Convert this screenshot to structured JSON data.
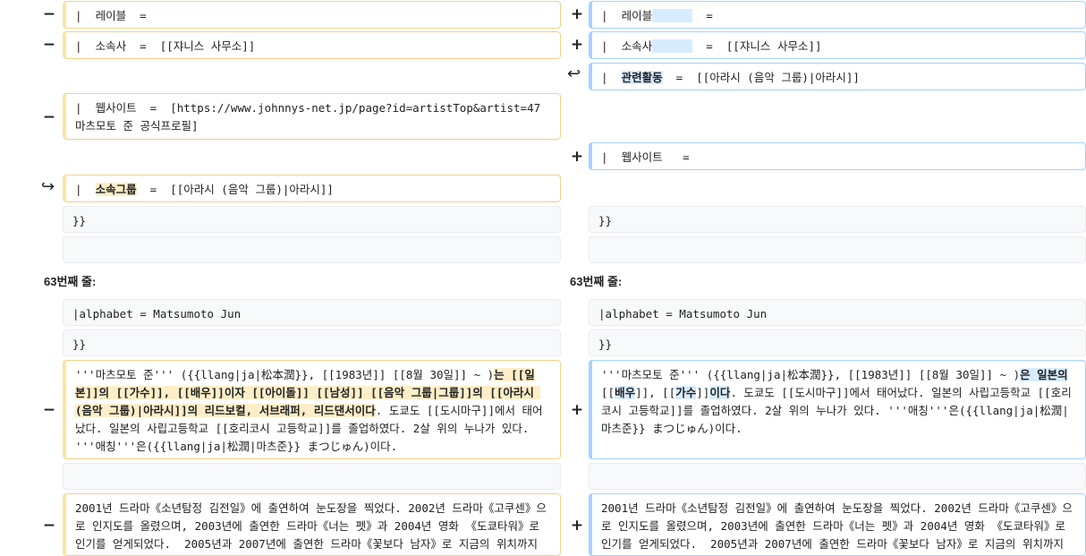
{
  "markers": {
    "minus": "−",
    "plus": "+",
    "move_to": "↩",
    "move_from": "↪"
  },
  "rows": {
    "r1": {
      "left": "|  레이블  =",
      "right_a": "|  레이블",
      "right_b": "  ="
    },
    "r2": {
      "left": "|  소속사  =  [[쟈니스 사무소]]",
      "right_a": "|  소속사",
      "right_b": "  =  [[쟈니스 사무소]]"
    },
    "r3": {
      "right_a": "|  ",
      "right_hl": "관련활동",
      "right_b": "  =  [[아라시 (음악 그룹)|아라시]]"
    },
    "r4": {
      "left": "|  웹사이트  =  [https://www.johnnys-net.jp/page?id=artistTop&artist=47 마츠모토 준 공식프로필]"
    },
    "r5": {
      "right": "|  웹사이트   ="
    },
    "r6": {
      "left_a": "|  ",
      "left_hl": "소속그룹",
      "left_b": "  =  [[아라시 (음악 그룹)|아라시]]"
    },
    "r7": {
      "left": "}}",
      "right": "}}"
    },
    "r8": {
      "left": "",
      "right": ""
    }
  },
  "line_headers": {
    "left": "63번째 줄:",
    "right": "63번째 줄:"
  },
  "rows2": {
    "c1": {
      "left": "|alphabet = Matsumoto Jun",
      "right": "|alphabet = Matsumoto Jun"
    },
    "c2": {
      "left": "}}",
      "right": "}}"
    },
    "c3": {
      "left_a": "'''마츠모토 준''' ({{llang|ja|松本潤}}, [[1983년]] [[8월 30일]] ~ )",
      "left_hl": "는 [[일본]]의 [[가수]], [[배우]]이자 [[아이돌]] [[남성]] [[음악 그룹|그룹]]의 [[아라시 (음악 그룹)|아라시]]의 리드보컬, 서브래퍼, 리드댄서이다",
      "left_b": ". 도쿄도 [[도시마구]]에서 태어났다. 일본의 사립고등학교 [[호리코시 고등학교]]를 졸업하였다. 2살 위의 누나가 있다. '''애칭'''은({{llang|ja|松潤|마츠준}} まつじゅん)이다.",
      "right_a": "'''마츠모토 준''' ({{llang|ja|松本潤}}, [[1983년]] [[8월 30일]] ~ )",
      "right_hl1": "은 일본의",
      "right_mid1": " [[",
      "right_hl2": "배우",
      "right_mid2": "]], [[",
      "right_hl3": "가수",
      "right_mid3": "]]",
      "right_hl4": "이다",
      "right_b": ". 도쿄도 [[도시마구]]에서 태어났다. 일본의 사립고등학교 [[호리코시 고등학교]]를 졸업하였다. 2살 위의 누나가 있다. '''애칭'''은({{llang|ja|松潤|마츠준}} まつじゅん)이다."
    },
    "c4": {
      "left": "",
      "right": ""
    },
    "c5": {
      "left": "2001년 드라마《소년탐정 김전일》에 출연하여 눈도장을 찍었다. 2002년 드라마《고쿠센》으로 인지도를 올렸으며, 2003년에 출연한 드라마《너는 펫》과 2004년 영화 《도쿄타워》로 인기를 얻게되었다.  2005년과 2007년에 출연한 드라마《꽃보다 남자》로 지금의 위치까지 오르게 된다.",
      "right": "2001년 드라마《소년탐정 김전일》에 출연하여 눈도장을 찍었다. 2002년 드라마《고쿠센》으로 인지도를 올렸으며, 2003년에 출연한 드라마《너는 펫》과 2004년 영화 《도쿄타워》로 인기를 얻게되었다.  2005년과 2007년에 출연한 드라마《꽃보다 남자》로 지금의 위치까지 오르게 된다."
    }
  }
}
